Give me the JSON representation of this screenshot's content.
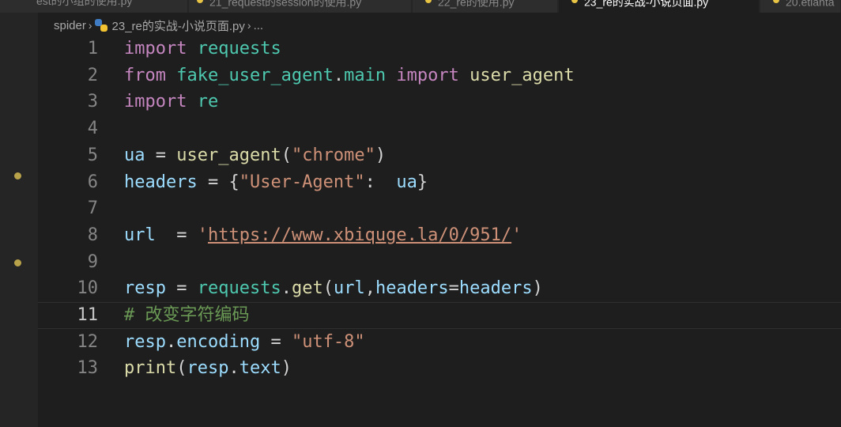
{
  "tabs": [
    {
      "label": "est的小组的使用.py",
      "active": false
    },
    {
      "label": "21_request的session的使用.py",
      "active": false
    },
    {
      "label": "22_re的使用.py",
      "active": false
    },
    {
      "label": "23_re的实战-小说页面.py",
      "active": true
    },
    {
      "label": "20.etlanta",
      "active": false
    }
  ],
  "breadcrumb": {
    "folder": "spider",
    "file": "23_re的实战-小说页面.py",
    "more": "..."
  },
  "editor": {
    "current_line": 11,
    "lines": [
      {
        "num": "1",
        "tokens": [
          [
            "kw",
            "import"
          ],
          [
            "op",
            " "
          ],
          [
            "mod",
            "requests"
          ]
        ]
      },
      {
        "num": "2",
        "tokens": [
          [
            "kw",
            "from"
          ],
          [
            "op",
            " "
          ],
          [
            "mod",
            "fake_user_agent"
          ],
          [
            "op",
            "."
          ],
          [
            "mod",
            "main"
          ],
          [
            "op",
            " "
          ],
          [
            "kw",
            "import"
          ],
          [
            "op",
            " "
          ],
          [
            "fn",
            "user_agent"
          ]
        ]
      },
      {
        "num": "3",
        "tokens": [
          [
            "kw",
            "import"
          ],
          [
            "op",
            " "
          ],
          [
            "mod",
            "re"
          ]
        ]
      },
      {
        "num": "4",
        "tokens": []
      },
      {
        "num": "5",
        "tokens": [
          [
            "var",
            "ua"
          ],
          [
            "op",
            " = "
          ],
          [
            "fn",
            "user_agent"
          ],
          [
            "op",
            "("
          ],
          [
            "str",
            "\"chrome\""
          ],
          [
            "op",
            ")"
          ]
        ]
      },
      {
        "num": "6",
        "tokens": [
          [
            "var",
            "headers"
          ],
          [
            "op",
            " = {"
          ],
          [
            "str",
            "\"User-Agent\""
          ],
          [
            "op",
            ":  "
          ],
          [
            "var",
            "ua"
          ],
          [
            "op",
            "}"
          ]
        ]
      },
      {
        "num": "7",
        "tokens": []
      },
      {
        "num": "8",
        "tokens": [
          [
            "var",
            "url"
          ],
          [
            "op",
            "  = "
          ],
          [
            "str",
            "'"
          ],
          [
            "url",
            "https://www.xbiquge.la/0/951/"
          ],
          [
            "str",
            "'"
          ]
        ]
      },
      {
        "num": "9",
        "tokens": []
      },
      {
        "num": "10",
        "tokens": [
          [
            "var",
            "resp"
          ],
          [
            "op",
            " = "
          ],
          [
            "mod",
            "requests"
          ],
          [
            "op",
            "."
          ],
          [
            "fn",
            "get"
          ],
          [
            "op",
            "("
          ],
          [
            "var",
            "url"
          ],
          [
            "op",
            ","
          ],
          [
            "var",
            "headers"
          ],
          [
            "op",
            "="
          ],
          [
            "var",
            "headers"
          ],
          [
            "op",
            ")"
          ]
        ]
      },
      {
        "num": "11",
        "tokens": [
          [
            "cmt",
            "# 改变字符编码"
          ]
        ]
      },
      {
        "num": "12",
        "tokens": [
          [
            "var",
            "resp"
          ],
          [
            "op",
            "."
          ],
          [
            "var",
            "encoding"
          ],
          [
            "op",
            " = "
          ],
          [
            "str",
            "\"utf-8\""
          ]
        ]
      },
      {
        "num": "13",
        "tokens": [
          [
            "fn",
            "print"
          ],
          [
            "op",
            "("
          ],
          [
            "var",
            "resp"
          ],
          [
            "op",
            "."
          ],
          [
            "var",
            "text"
          ],
          [
            "op",
            ")"
          ]
        ]
      }
    ]
  },
  "colors": {
    "background": "#1e1e1e",
    "keyword": "#c586c0",
    "module": "#4ec9b0",
    "variable": "#9cdcfe",
    "function": "#dcdcaa",
    "string": "#ce9178",
    "comment": "#6a9955",
    "line_number": "#858585"
  },
  "gutter_markers": [
    "line-6-marker",
    "line-9-marker"
  ]
}
